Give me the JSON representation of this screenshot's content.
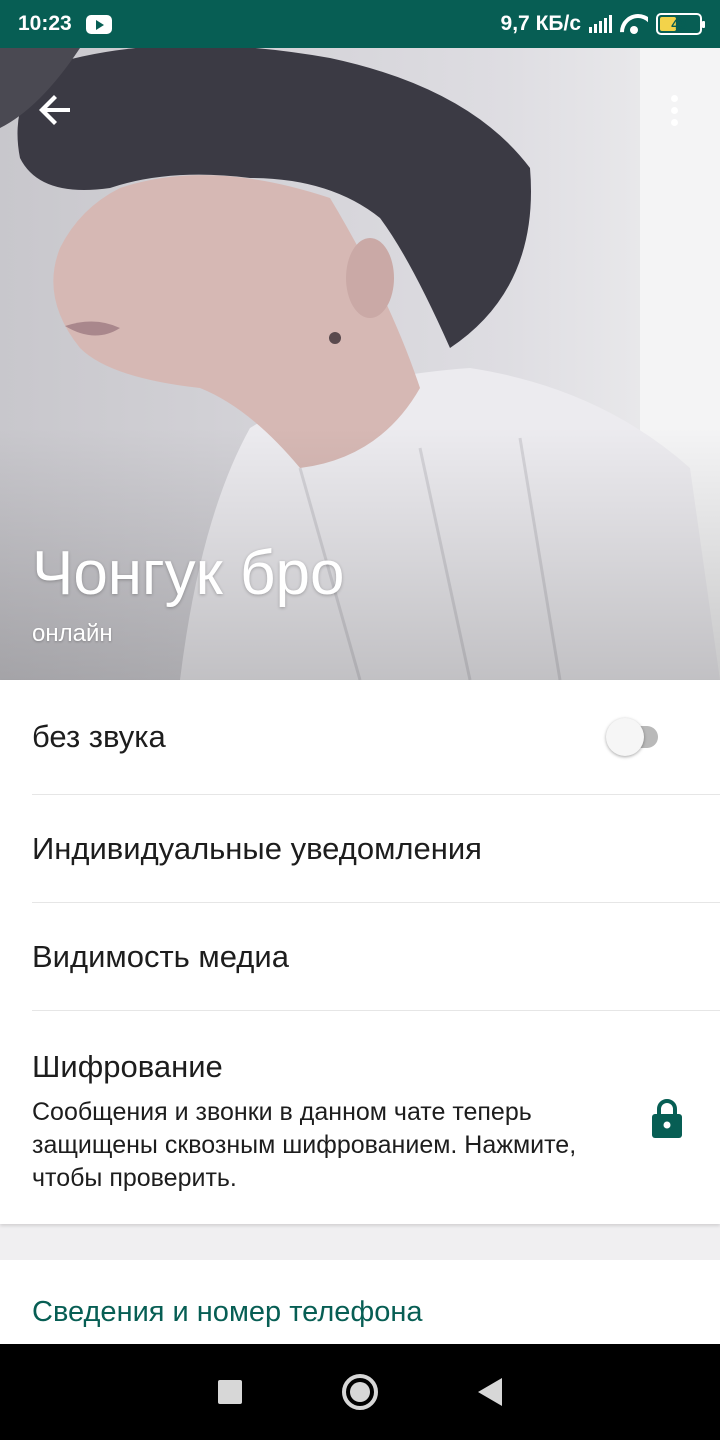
{
  "status_bar": {
    "time": "10:23",
    "network_speed": "9,7 КБ/с",
    "battery": "43",
    "battery_level": 0.43,
    "icons": [
      "youtube-icon",
      "signal-icon",
      "wifi-icon",
      "battery-icon"
    ]
  },
  "header": {
    "contact_name": "Чонгук бро",
    "status": "онлайн",
    "icons": [
      "back-arrow-icon",
      "more-vert-icon"
    ]
  },
  "settings": {
    "mute_label": "без звука",
    "mute_enabled": false,
    "custom_notifications_label": "Индивидуальные уведомления",
    "media_visibility_label": "Видимость медиа",
    "encryption": {
      "title": "Шифрование",
      "description": "Сообщения и звонки в данном чате теперь защищены сквозным шифрованием. Нажмите, чтобы проверить.",
      "icon": "lock-icon"
    }
  },
  "info_section": {
    "title": "Сведения и номер телефона"
  },
  "colors": {
    "primary": "#075e54",
    "accent_green": "#075e54",
    "background": "#f0eff1"
  }
}
